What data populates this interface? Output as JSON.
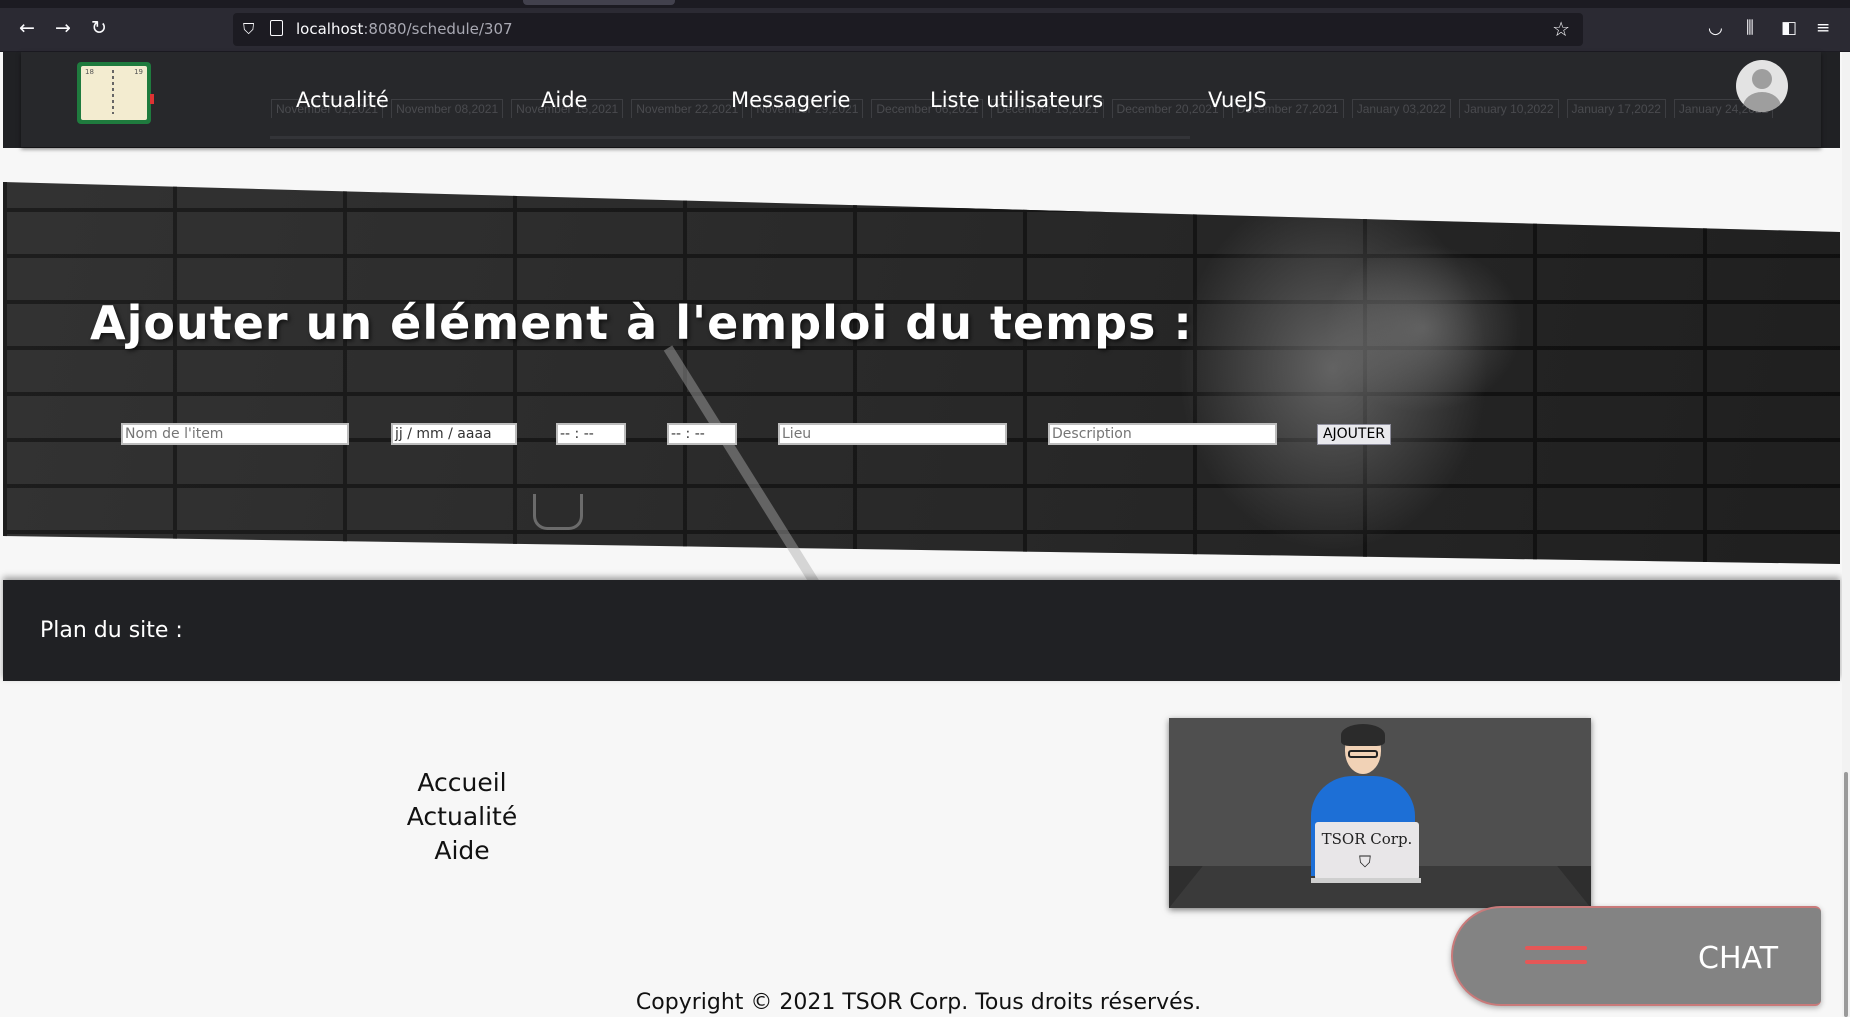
{
  "browser": {
    "url_host": "localhost",
    "url_rest": ":8080/schedule/307"
  },
  "header": {
    "nav": [
      "Actualité",
      "Aide",
      "Messagerie",
      "Liste utilisateurs",
      "VueJS"
    ],
    "logo_numbers": [
      "18",
      "19"
    ],
    "ghost_dates": [
      "November 01,2021",
      "November 08,2021",
      "November 15,2021",
      "November 22,2021",
      "November 29,2021",
      "December 06,2021",
      "December 13,2021",
      "December 20,2021",
      "December 27,2021",
      "January 03,2022",
      "January 10,2022",
      "January 17,2022",
      "January 24,2022"
    ]
  },
  "banner": {
    "title": "Ajouter un élément à l'emploi du temps :"
  },
  "form": {
    "name_placeholder": "Nom de l'item",
    "date_placeholder": "jj / mm / aaaa",
    "start_time_placeholder": "-- : --",
    "end_time_placeholder": "-- : --",
    "place_placeholder": "Lieu",
    "description_placeholder": "Description",
    "submit_label": "AJOUTER"
  },
  "sitemap": {
    "label": "Plan du site :"
  },
  "footer": {
    "links": [
      "Accueil",
      "Actualité",
      "Aide"
    ],
    "illustration_brand": "TSOR Corp.",
    "copyright": "Copyright © 2021 TSOR Corp. Tous droits réservés."
  },
  "chat": {
    "label": "CHAT"
  },
  "colors": {
    "header_bg": "#202124",
    "chat_bg": "#838383",
    "chat_accent": "#e55757"
  }
}
